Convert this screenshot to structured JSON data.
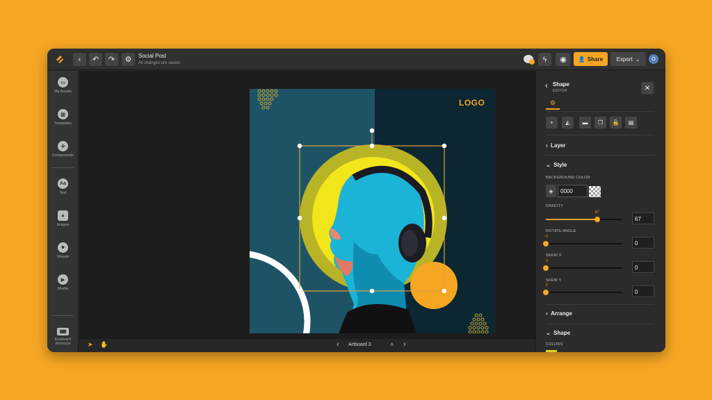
{
  "app": {
    "doc_title": "Social Post",
    "doc_status": "All changes are saved.",
    "share_label": "Share",
    "export_label": "Export",
    "avatar_initial": "O"
  },
  "sidebar": {
    "items": [
      {
        "label": "My Assets",
        "icon": "folder-icon"
      },
      {
        "label": "Templates",
        "icon": "template-icon"
      },
      {
        "label": "Components",
        "icon": "components-icon"
      },
      {
        "label": "Text",
        "icon": "text-icon"
      },
      {
        "label": "Images",
        "icon": "image-icon"
      },
      {
        "label": "Visuals",
        "icon": "visuals-icon"
      },
      {
        "label": "Media",
        "icon": "play-icon"
      },
      {
        "label": "Keyboard shortcuts",
        "icon": "keyboard-icon"
      }
    ],
    "text_icon_glyph": "Aa"
  },
  "canvas": {
    "artboard_name": "Artboard 3",
    "logo_text": "LOGO",
    "colors": {
      "left_bg": "#1e5366",
      "right_bg": "#0c2632",
      "accent": "#f5a623",
      "ring": "#b8b426",
      "disc": "#f2e51a",
      "selection": "#e0a33a"
    }
  },
  "panel": {
    "title": "Shape",
    "subtitle": "EDITOR",
    "sections": {
      "layer": "Layer",
      "style": "Style",
      "arrange": "Arrange",
      "shape": "Shape"
    },
    "background_color_label": "BACKGROUND COLOR",
    "background_color_value": "0000",
    "opacity": {
      "label": "OPACITY",
      "value": 67,
      "min": 0,
      "max": 100,
      "display": "67"
    },
    "rotate": {
      "label": "ROTATE ANGLE",
      "value": 0,
      "min": 0,
      "max": 360,
      "display": "0"
    },
    "skew_x": {
      "label": "SKEW X",
      "value": 0,
      "min": 0,
      "max": 100,
      "display": "0"
    },
    "skew_y": {
      "label": "SKEW Y",
      "value": 0,
      "min": 0,
      "max": 100,
      "display": "0"
    },
    "colors_label": "COLORS"
  }
}
